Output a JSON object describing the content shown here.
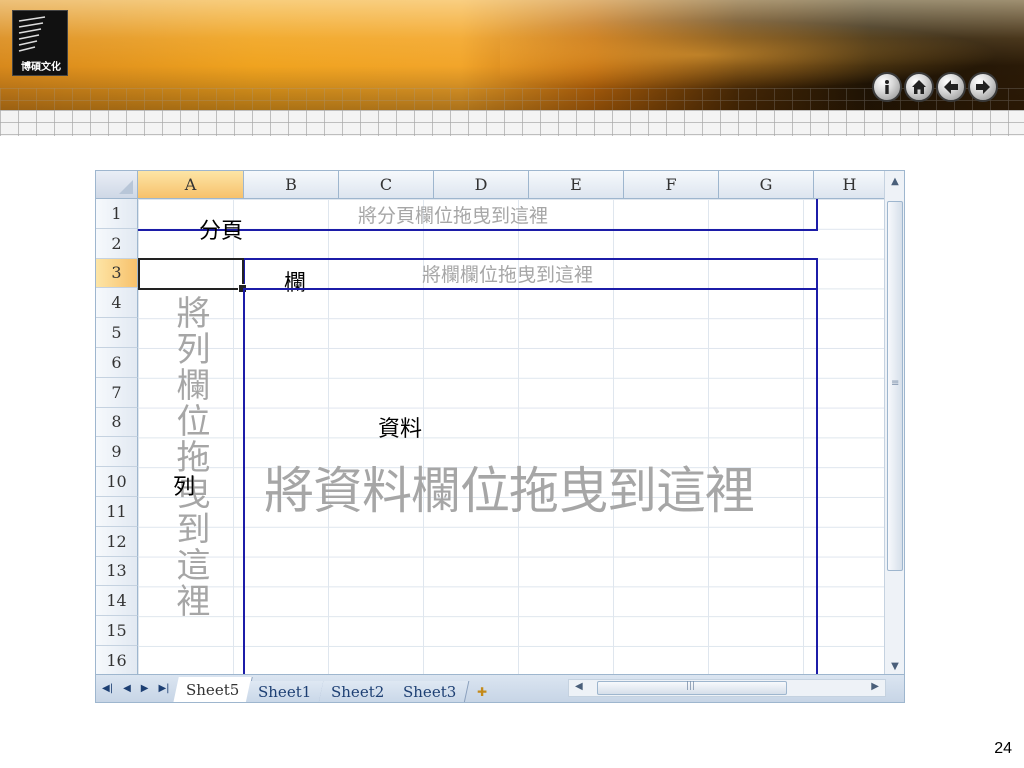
{
  "logo": {
    "text": "博碩文化"
  },
  "nav": {
    "buttons": [
      {
        "name": "info",
        "icon": "info-icon"
      },
      {
        "name": "home",
        "icon": "home-icon"
      },
      {
        "name": "back",
        "icon": "arrow-left-icon"
      },
      {
        "name": "forward",
        "icon": "arrow-right-icon"
      }
    ]
  },
  "sheet": {
    "columns": [
      "A",
      "B",
      "C",
      "D",
      "E",
      "F",
      "G",
      "H"
    ],
    "active_column": "A",
    "rows": [
      "1",
      "2",
      "3",
      "4",
      "5",
      "6",
      "7",
      "8",
      "9",
      "10",
      "11",
      "12",
      "13",
      "14",
      "15",
      "16"
    ],
    "active_row": "3",
    "zones": {
      "page": {
        "hint": "將分頁欄位拖曳到這裡",
        "label": "分頁"
      },
      "column": {
        "hint": "將欄欄位拖曳到這裡",
        "label": "欄"
      },
      "row": {
        "hint": "將列欄位拖曳到這裡",
        "label": "列"
      },
      "data": {
        "hint": "將資料欄位拖曳到這裡",
        "label": "資料"
      }
    },
    "tabs": [
      "Sheet5",
      "Sheet1",
      "Sheet2",
      "Sheet3"
    ],
    "active_tab": "Sheet5"
  },
  "slide": {
    "page_number": "24"
  },
  "colors": {
    "zone_border": "#1c1ca8",
    "hint_text": "#a6a6a6",
    "active_header": "#f7c16b"
  }
}
